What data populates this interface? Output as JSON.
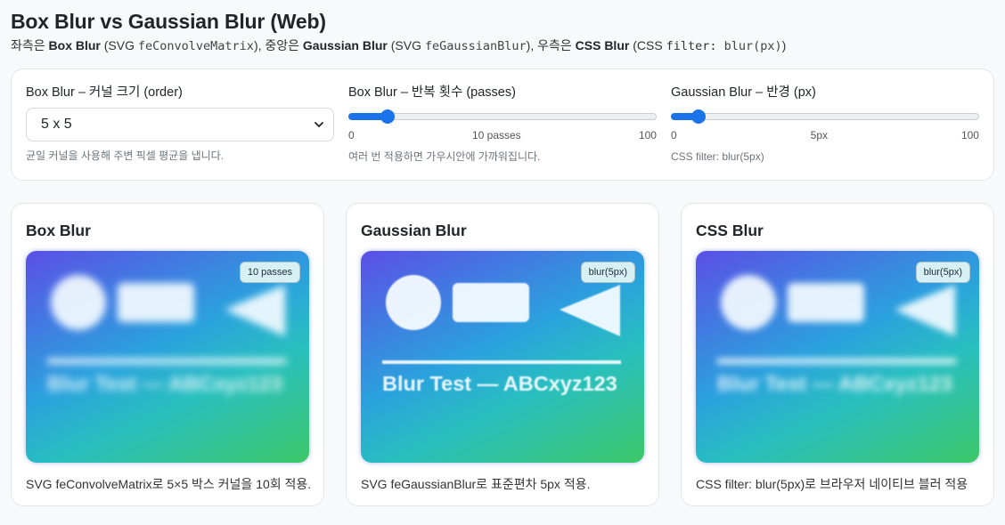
{
  "header": {
    "title": "Box Blur vs Gaussian Blur (Web)",
    "sub_1": "좌측은 ",
    "sub_2": "Box Blur",
    "sub_3": " (SVG ",
    "sub_4": "feConvolveMatrix",
    "sub_5": "), 중앙은 ",
    "sub_6": "Gaussian Blur",
    "sub_7": " (SVG ",
    "sub_8": "feGaussianBlur",
    "sub_9": "), 우측은 ",
    "sub_10": "CSS Blur",
    "sub_11": " (CSS ",
    "sub_12": "filter: ",
    "sub_13": "blur(px)",
    "sub_14": ")"
  },
  "controls": {
    "order": {
      "label": "Box Blur – 커널 크기 (order)",
      "value": "5 x 5",
      "hint": "균일 커널을 사용해 주변 픽셀 평균을 냅니다."
    },
    "passes": {
      "label": "Box Blur – 반복 횟수 (passes)",
      "min": "0",
      "current": "10 passes",
      "max": "100",
      "level": 0.11,
      "hint": "여러 번 적용하면 가우시안에 가까워집니다."
    },
    "radius": {
      "label": "Gaussian Blur – 반경 (px)",
      "min": "0",
      "current": "5px",
      "max": "100",
      "level": 0.07,
      "hint": "CSS filter: blur(5px)"
    }
  },
  "cards": [
    {
      "title": "Box Blur",
      "badge": "10 passes",
      "desc": "SVG feConvolveMatrix로 5×5 박스 커널을 10회 적용."
    },
    {
      "title": "Gaussian Blur",
      "badge": "blur(5px)",
      "desc": "SVG feGaussianBlur로 표준편차 5px 적용."
    },
    {
      "title": "CSS Blur",
      "badge": "blur(5px)",
      "desc": "CSS filter: blur(5px)로 브라우저 네이티브 블러 적용"
    }
  ],
  "preview_text": "Blur Test — ABCxyz123",
  "colors": {
    "accent": "#1a73e8",
    "gradient_start": "#5b4fe6",
    "gradient_end": "#3ec96a"
  }
}
